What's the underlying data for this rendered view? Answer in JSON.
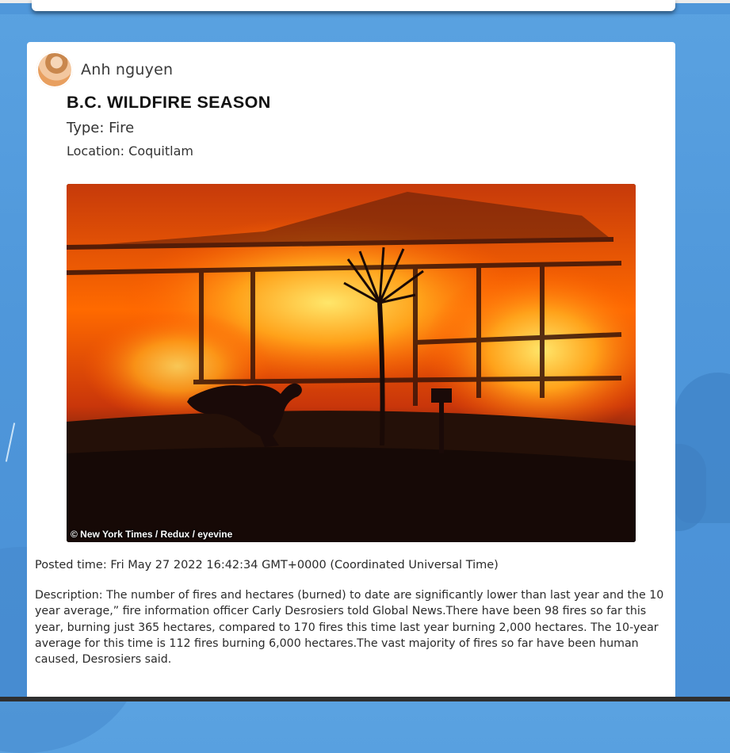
{
  "post": {
    "author": {
      "name": "Anh nguyen",
      "avatar_icon": "user-avatar"
    },
    "title": "B.C. WILDFIRE SEASON",
    "type_line": "Type: Fire",
    "location_line": "Location: Coquitlam",
    "image": {
      "credit": "© New York Times / Redux / eyevine"
    },
    "posted_time": "Posted time: Fri May 27 2022 16:42:34 GMT+0000 (Coordinated Universal Time)",
    "description": "Description: The number of fires and hectares (burned) to date are significantly lower than last year and the 10 year average,” fire information officer Carly Desrosiers told Global News.There have been 98 fires so far this year, burning just 365 hectares, compared to 170 fires this time last year burning 2,000 hectares. The 10-year average for this time is 112 fires burning 6,000 hectares.The vast majority of fires so far have been human caused, Desrosiers said."
  },
  "colors": {
    "background": "#4f97da",
    "card": "#ffffff",
    "fire": "#ff6a00"
  }
}
